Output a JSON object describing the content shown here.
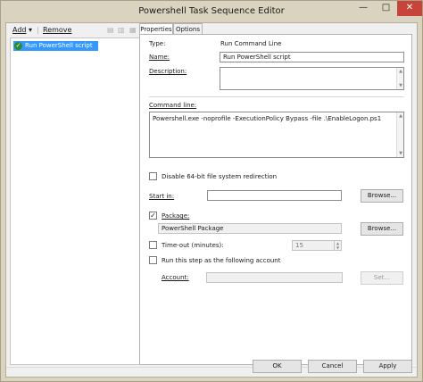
{
  "window": {
    "title": "Powershell Task Sequence Editor"
  },
  "titlebar_buttons": {
    "minimize": "—",
    "maximize": "□",
    "close": "✕"
  },
  "toolbar": {
    "add_label": "Add",
    "add_arrow": "▾",
    "remove_label": "Remove"
  },
  "tree": {
    "items": [
      {
        "label": "Run PowerShell script",
        "status": "success"
      }
    ]
  },
  "tabs": [
    {
      "label": "Properties",
      "selected": true
    },
    {
      "label": "Options",
      "selected": false
    }
  ],
  "properties": {
    "type_label": "Type:",
    "type_value": "Run Command Line",
    "name_label": "Name:",
    "name_value": "Run PowerShell script",
    "description_label": "Description:",
    "description_value": "",
    "command_line_label": "Command line:",
    "command_line_value": "Powershell.exe -noprofile -ExecutionPolicy Bypass -file .\\EnableLogon.ps1",
    "disable_redirection_label": "Disable 64-bit file system redirection",
    "disable_redirection_checked": false,
    "start_in_label": "Start in:",
    "start_in_value": "",
    "browse_label": "Browse...",
    "package_label": "Package:",
    "package_checked": true,
    "package_value": "PowerShell Package",
    "package_browse_label": "Browse...",
    "timeout_label": "Time-out (minutes):",
    "timeout_checked": false,
    "timeout_value": "15",
    "run_as_label": "Run this step as the following account",
    "run_as_checked": false,
    "account_label": "Account:",
    "account_value": "",
    "set_label": "Set..."
  },
  "footer": {
    "ok_label": "OK",
    "cancel_label": "Cancel",
    "apply_label": "Apply"
  },
  "colors": {
    "selection": "#3399ff",
    "success_icon": "#2d8c2d",
    "close_button": "#c7443b",
    "frame": "#d9d3bf"
  }
}
